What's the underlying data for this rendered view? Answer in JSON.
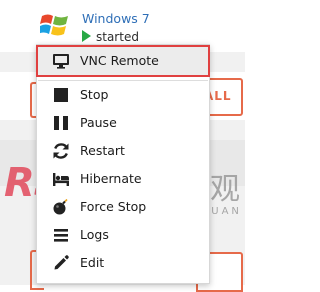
{
  "vm": {
    "name": "Windows 7",
    "status": "started",
    "icon": "windows-logo-icon",
    "status_icon": "play-icon"
  },
  "background": {
    "right_button_text": "ALL",
    "bottom_right_button_text": "H"
  },
  "watermark": {
    "brand": "RSG",
    "cn": "人生观",
    "sub": "REN SHENG GUAN"
  },
  "menu": {
    "items": [
      {
        "label": "VNC Remote",
        "icon": "monitor-icon",
        "highlighted": true
      },
      {
        "label": "Stop",
        "icon": "stop-icon"
      },
      {
        "label": "Pause",
        "icon": "pause-icon"
      },
      {
        "label": "Restart",
        "icon": "restart-icon"
      },
      {
        "label": "Hibernate",
        "icon": "bed-icon"
      },
      {
        "label": "Force Stop",
        "icon": "bomb-icon"
      },
      {
        "label": "Logs",
        "icon": "list-icon"
      },
      {
        "label": "Edit",
        "icon": "pencil-icon"
      }
    ]
  },
  "colors": {
    "accent_red": "#e04040",
    "play_green": "#27a844",
    "vm_name_blue": "#2f6fb7",
    "orange_outline": "#e66a4a"
  }
}
